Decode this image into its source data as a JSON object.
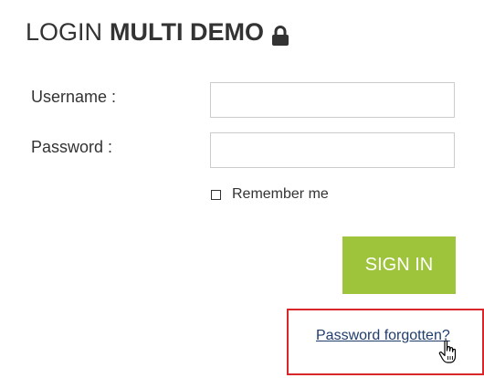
{
  "header": {
    "title_light": "LOGIN",
    "title_bold": "MULTI DEMO",
    "icon": "lock-icon"
  },
  "form": {
    "username_label": "Username :",
    "username_value": "",
    "password_label": "Password :",
    "password_value": "",
    "remember_label": "Remember me",
    "remember_checked": false,
    "signin_label": "SIGN IN",
    "forgot_label": "Password forgotten?"
  },
  "colors": {
    "accent": "#9dc43a",
    "link": "#1f3d6b",
    "highlight": "#d8262b",
    "text": "#333333"
  }
}
